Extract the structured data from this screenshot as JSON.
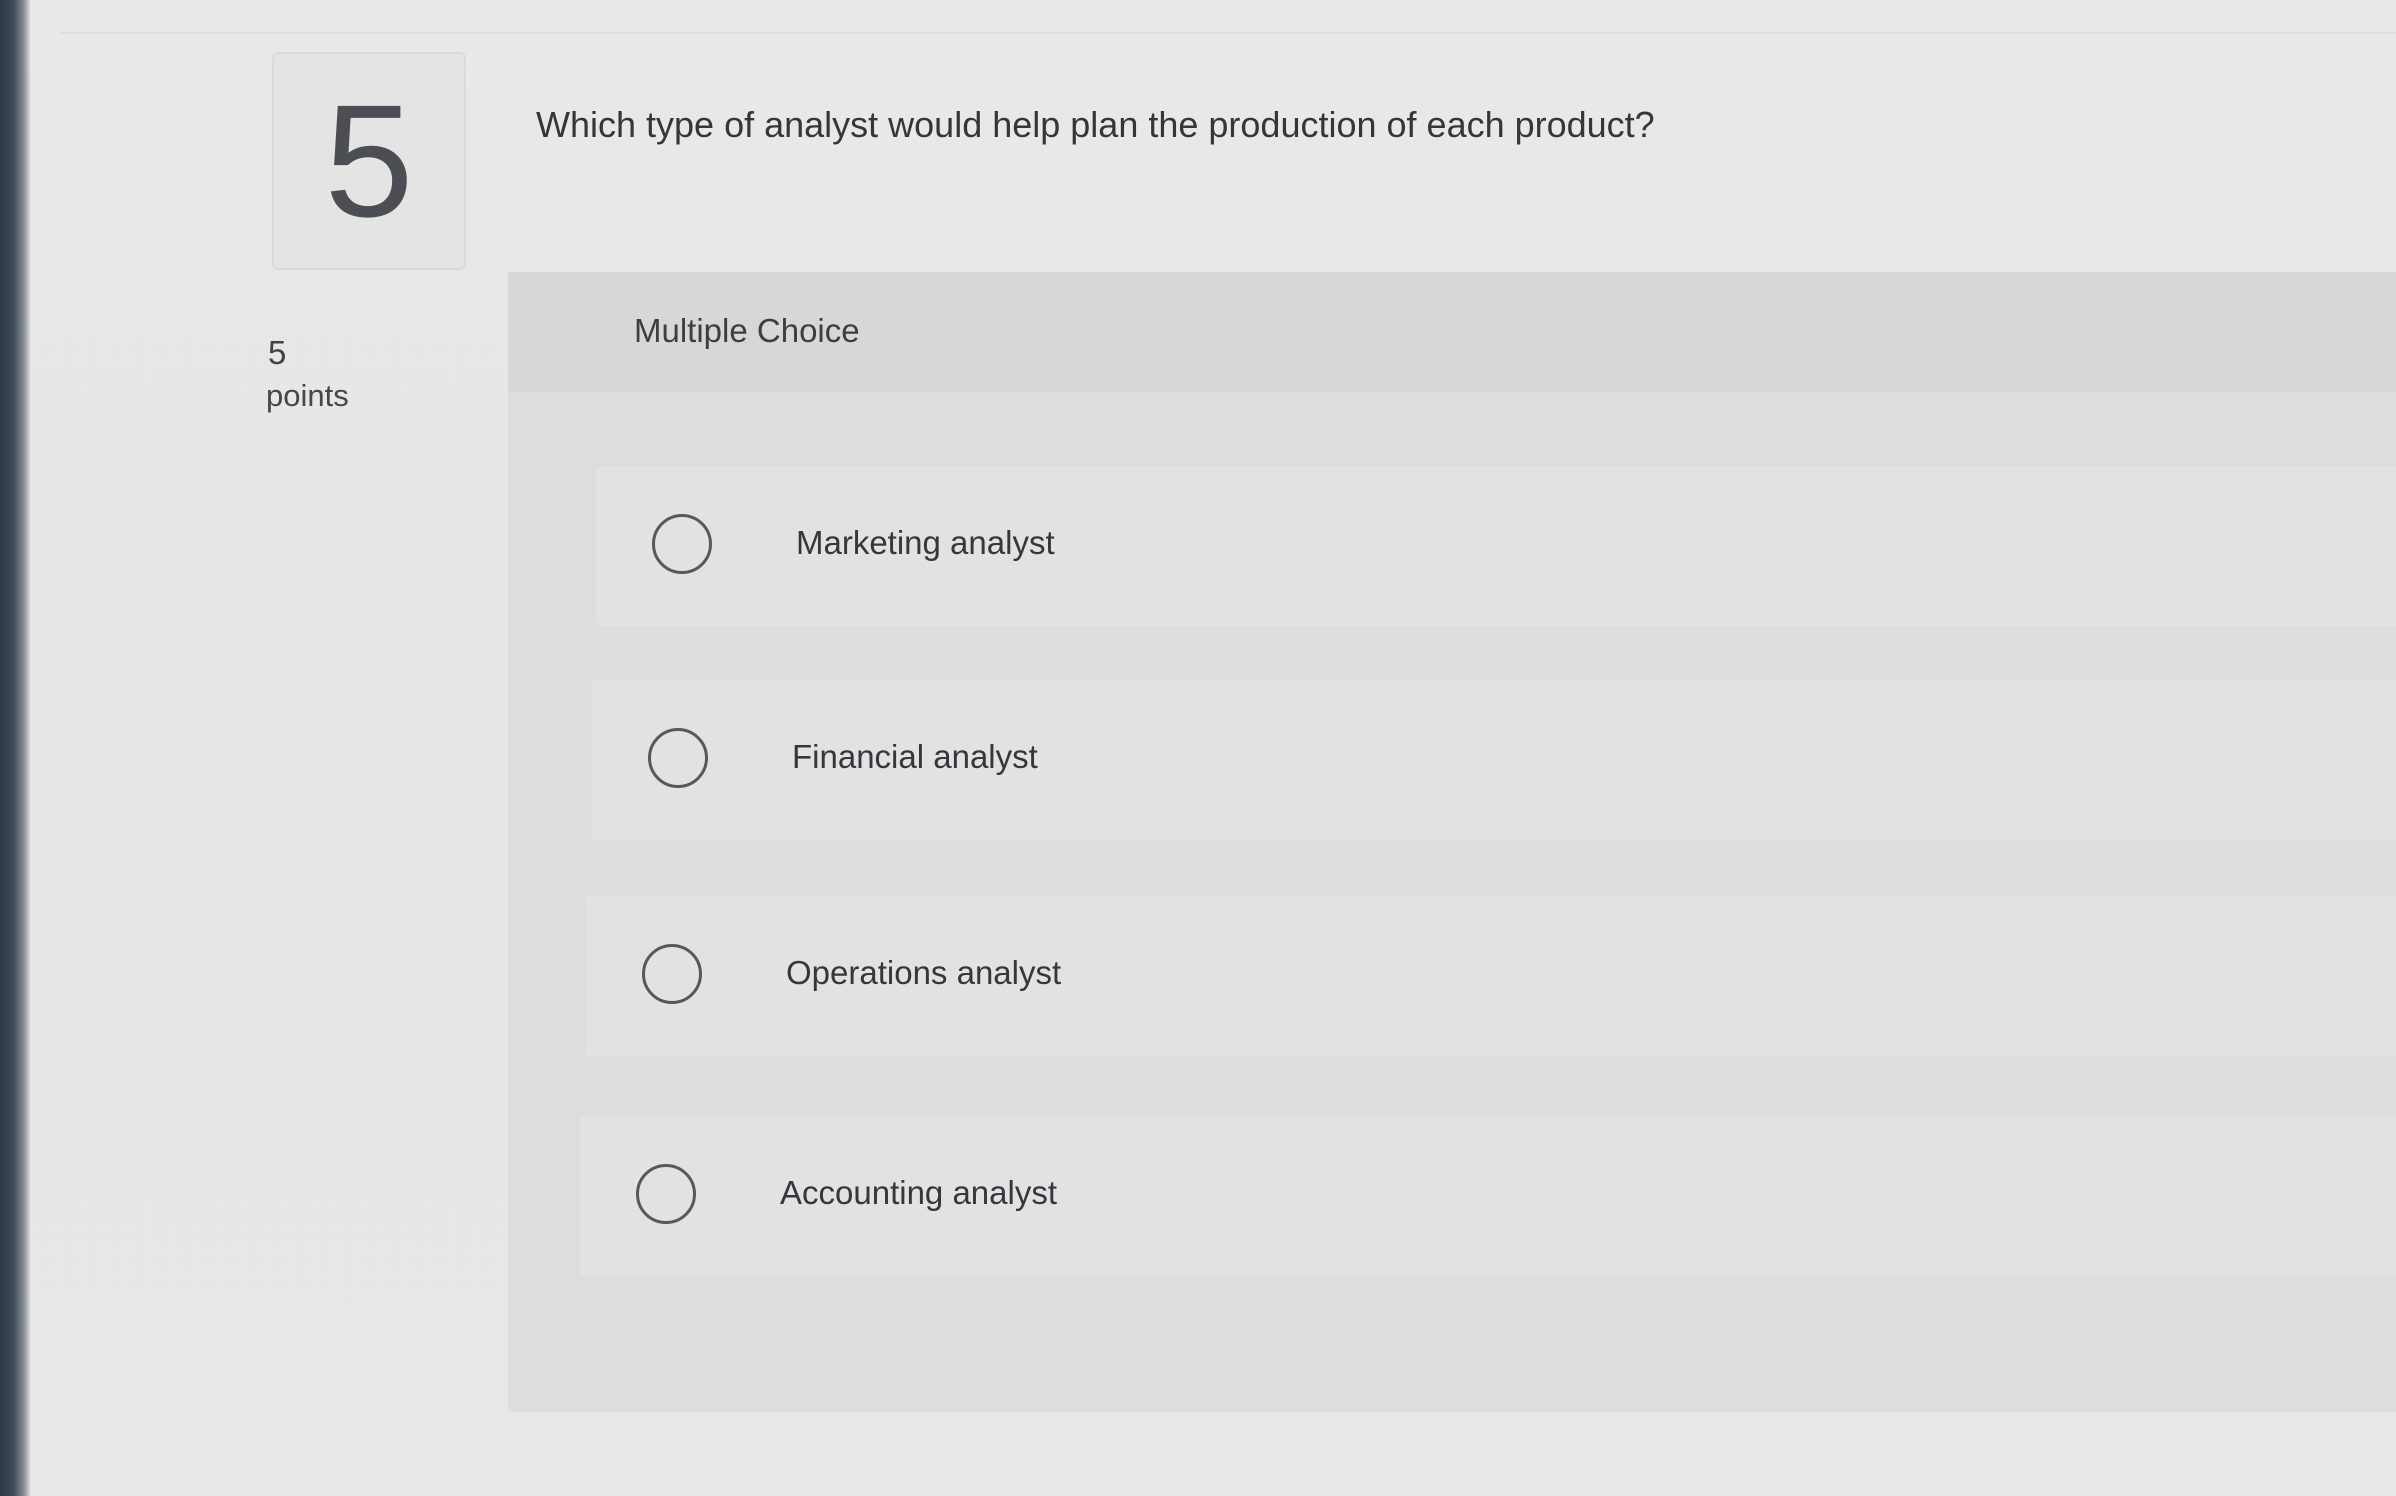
{
  "question": {
    "number": "5",
    "text": "Which type of analyst would help plan the production of each product?",
    "points_value": "5",
    "points_label": "points"
  },
  "choices": {
    "type_label": "Multiple Choice",
    "options": [
      {
        "label": "Marketing analyst"
      },
      {
        "label": "Financial analyst"
      },
      {
        "label": "Operations analyst"
      },
      {
        "label": "Accounting analyst"
      }
    ]
  },
  "colors": {
    "background": "#e6e7e6",
    "panel": "#dcdddc",
    "text": "#33373b",
    "radio_border": "#55595d"
  },
  "icons": {
    "radio": "radio-circle-icon"
  }
}
